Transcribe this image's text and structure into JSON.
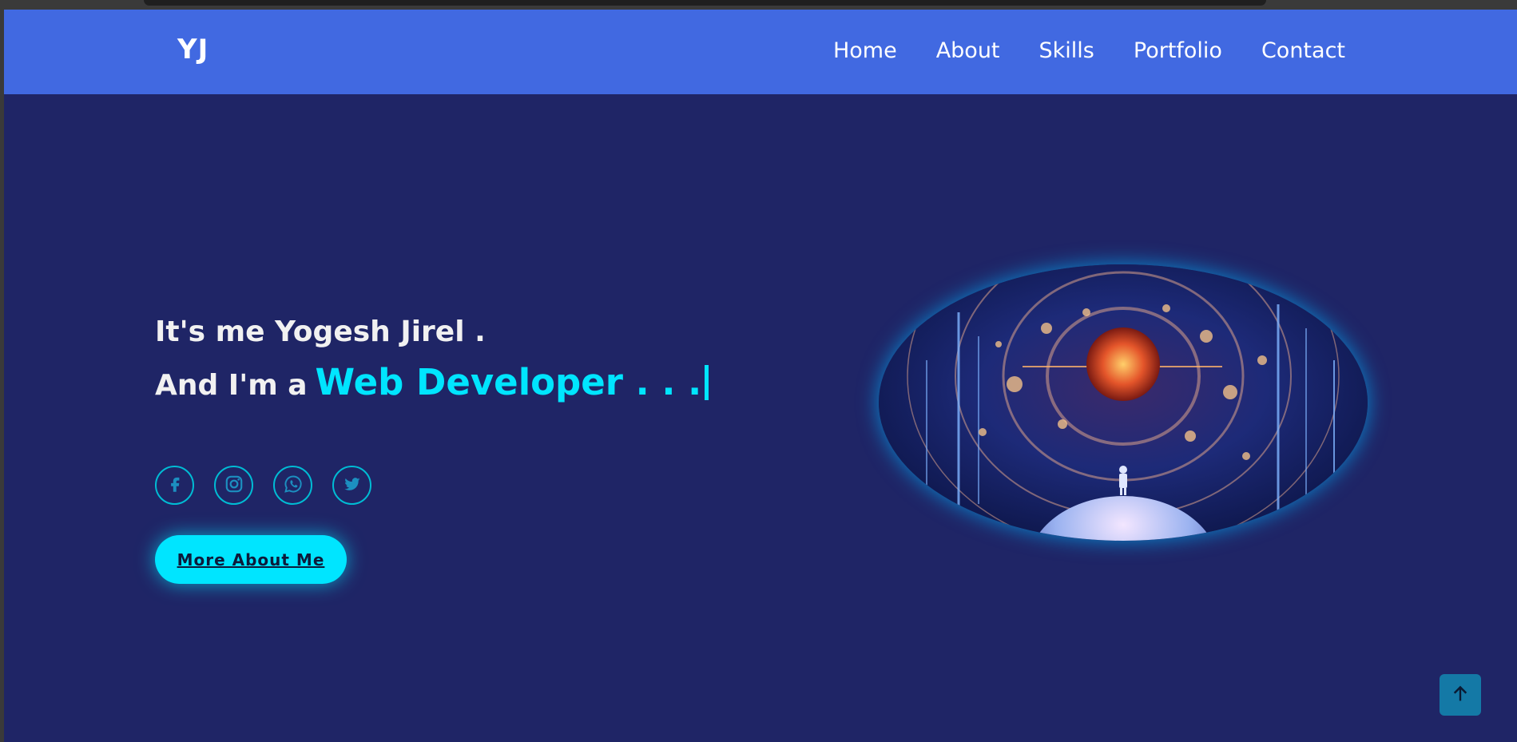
{
  "header": {
    "logo": "YJ",
    "nav": [
      "Home",
      "About",
      "Skills",
      "Portfolio",
      "Contact"
    ]
  },
  "hero": {
    "intro": "It's me Yogesh Jirel .",
    "prefix": "And I'm a",
    "role": "Web Developer . . ."
  },
  "socials": [
    "facebook-icon",
    "instagram-icon",
    "whatsapp-icon",
    "twitter-icon"
  ],
  "cta": {
    "label": "More About Me"
  },
  "colors": {
    "page_bg": "#1f2566",
    "header_bg": "#4169e1",
    "accent": "#00e5ff",
    "scroll_top_bg": "#1479a6"
  },
  "scroll_top_icon": "arrow-up-icon"
}
